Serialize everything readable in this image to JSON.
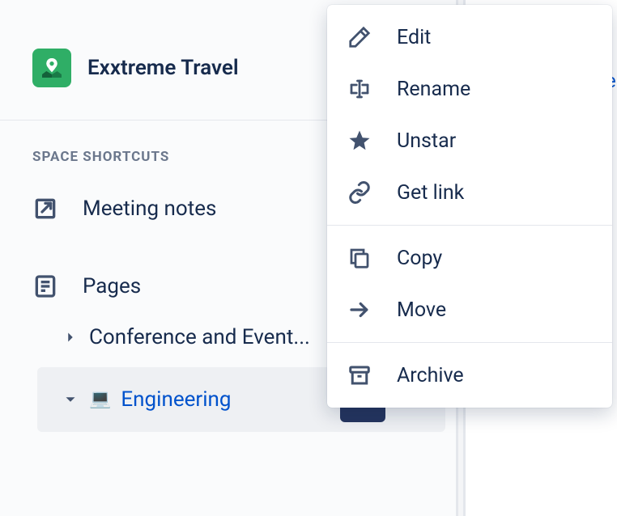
{
  "space": {
    "name": "Exxtreme Travel"
  },
  "section_label": "Space shortcuts",
  "shortcuts": [
    {
      "icon": "external-link-icon",
      "label": "Meeting notes"
    }
  ],
  "pages_label": "Pages",
  "tree": [
    {
      "expanded": false,
      "label": "Conference and Event..."
    },
    {
      "expanded": true,
      "emoji": "💻",
      "label": "Engineering",
      "active": true
    }
  ],
  "menu": {
    "groups": [
      [
        {
          "icon": "pencil-icon",
          "label": "Edit"
        },
        {
          "icon": "rename-icon",
          "label": "Rename"
        },
        {
          "icon": "star-icon",
          "label": "Unstar"
        },
        {
          "icon": "link-icon",
          "label": "Get link"
        }
      ],
      [
        {
          "icon": "copy-icon",
          "label": "Copy"
        },
        {
          "icon": "arrow-right-icon",
          "label": "Move"
        }
      ],
      [
        {
          "icon": "archive-icon",
          "label": "Archive"
        }
      ]
    ]
  },
  "doc_fragment": "e"
}
